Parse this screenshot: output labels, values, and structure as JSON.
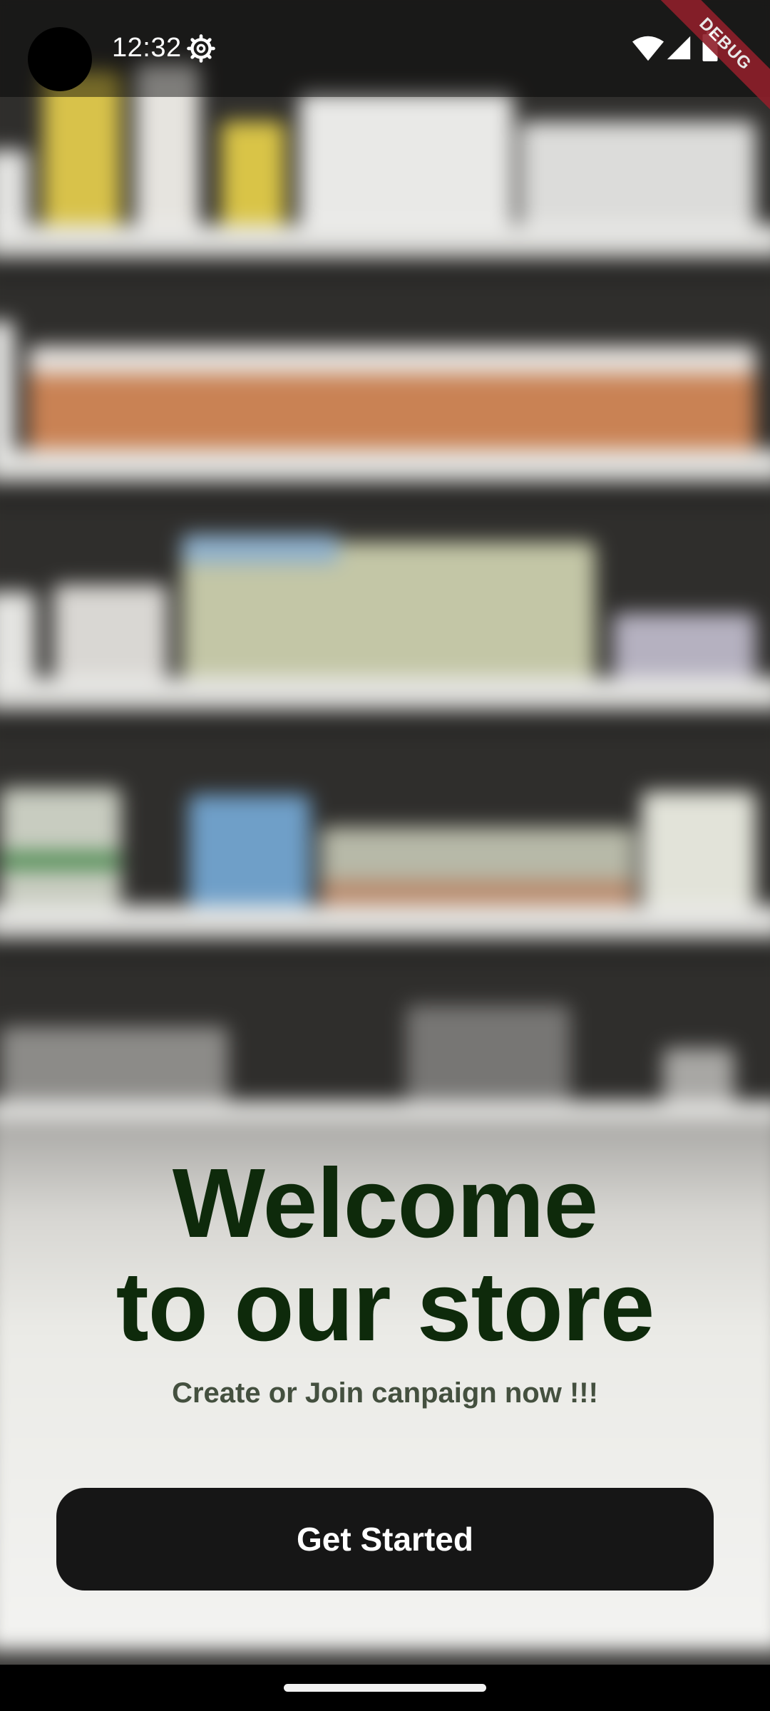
{
  "status_bar": {
    "time": "12:32",
    "icons": [
      "settings-icon",
      "wifi-icon",
      "signal-icon",
      "battery-icon"
    ]
  },
  "debug_banner": "DEBUG",
  "welcome": {
    "title_line1": "Welcome",
    "title_line2": "to our store",
    "subtitle": "Create or Join canpaign now !!!"
  },
  "actions": {
    "get_started_label": "Get Started"
  },
  "colors": {
    "title": "#0e2a0b",
    "subtitle": "#44503f",
    "button_bg": "#161616",
    "button_text": "#ffffff",
    "debug_ribbon": "#8f1f2a"
  }
}
